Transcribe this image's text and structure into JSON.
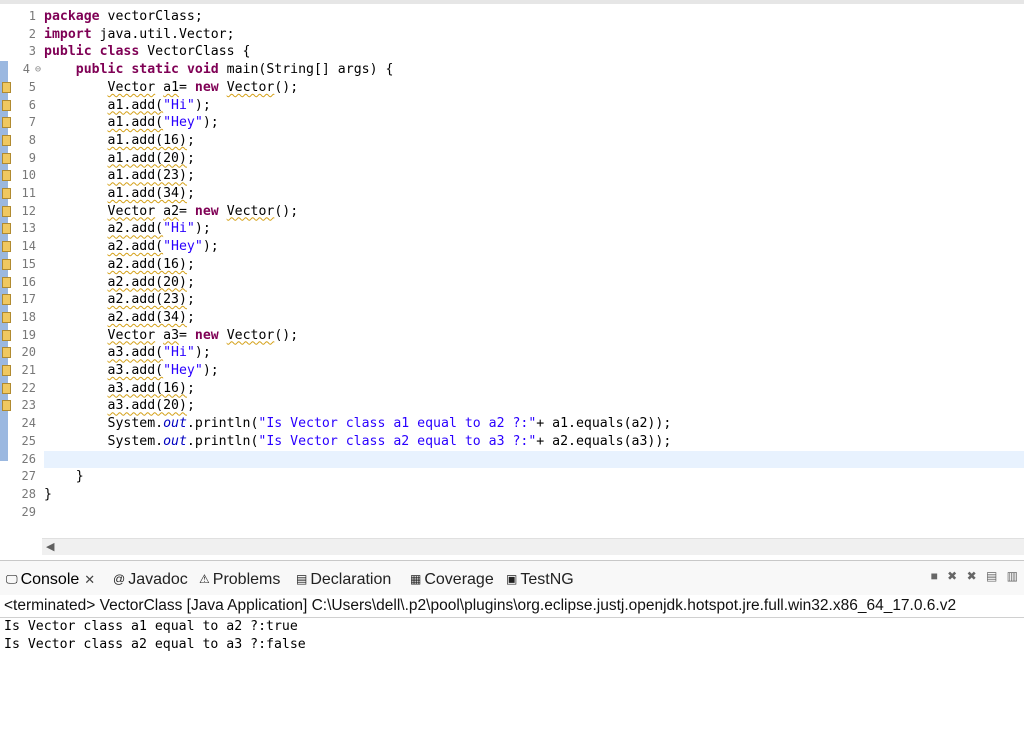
{
  "editor": {
    "lines": [
      {
        "n": "1",
        "parts": [
          [
            "kw",
            "package"
          ],
          [
            "t",
            " vectorClass;"
          ]
        ]
      },
      {
        "n": "2",
        "parts": [
          [
            "kw",
            "import"
          ],
          [
            "t",
            " java.util.Vector;"
          ]
        ]
      },
      {
        "n": "3",
        "parts": [
          [
            "kw",
            "public"
          ],
          [
            "t",
            " "
          ],
          [
            "kw",
            "class"
          ],
          [
            "t",
            " VectorClass {"
          ]
        ]
      },
      {
        "n": "4",
        "fold": "⊖",
        "parts": [
          [
            "t",
            "    "
          ],
          [
            "kw",
            "public"
          ],
          [
            "t",
            " "
          ],
          [
            "kw",
            "static"
          ],
          [
            "t",
            " "
          ],
          [
            "kw",
            "void"
          ],
          [
            "t",
            " main(String[] args) {"
          ]
        ]
      },
      {
        "n": "5",
        "marker": true,
        "parts": [
          [
            "t",
            "        "
          ],
          [
            "warn",
            "Vector"
          ],
          [
            "t",
            " "
          ],
          [
            "warn",
            "a1"
          ],
          [
            "t",
            "= "
          ],
          [
            "kw",
            "new"
          ],
          [
            "t",
            " "
          ],
          [
            "warn",
            "Vector"
          ],
          [
            "t",
            "();"
          ]
        ]
      },
      {
        "n": "6",
        "marker": true,
        "parts": [
          [
            "t",
            "        "
          ],
          [
            "warn",
            "a1.add("
          ],
          [
            "str",
            "\"Hi\""
          ],
          [
            "t",
            ");"
          ]
        ]
      },
      {
        "n": "7",
        "marker": true,
        "parts": [
          [
            "t",
            "        "
          ],
          [
            "warn",
            "a1.add("
          ],
          [
            "str",
            "\"Hey\""
          ],
          [
            "t",
            ");"
          ]
        ]
      },
      {
        "n": "8",
        "marker": true,
        "parts": [
          [
            "t",
            "        "
          ],
          [
            "warn",
            "a1.add(16)"
          ],
          [
            "t",
            ";"
          ]
        ]
      },
      {
        "n": "9",
        "marker": true,
        "parts": [
          [
            "t",
            "        "
          ],
          [
            "warn",
            "a1.add(20)"
          ],
          [
            "t",
            ";"
          ]
        ]
      },
      {
        "n": "10",
        "marker": true,
        "parts": [
          [
            "t",
            "        "
          ],
          [
            "warn",
            "a1.add(23)"
          ],
          [
            "t",
            ";"
          ]
        ]
      },
      {
        "n": "11",
        "marker": true,
        "parts": [
          [
            "t",
            "        "
          ],
          [
            "warn",
            "a1.add(34)"
          ],
          [
            "t",
            ";"
          ]
        ]
      },
      {
        "n": "12",
        "marker": true,
        "parts": [
          [
            "t",
            "        "
          ],
          [
            "warn",
            "Vector"
          ],
          [
            "t",
            " "
          ],
          [
            "warn",
            "a2"
          ],
          [
            "t",
            "= "
          ],
          [
            "kw",
            "new"
          ],
          [
            "t",
            " "
          ],
          [
            "warn",
            "Vector"
          ],
          [
            "t",
            "();"
          ]
        ]
      },
      {
        "n": "13",
        "marker": true,
        "parts": [
          [
            "t",
            "        "
          ],
          [
            "warn",
            "a2.add("
          ],
          [
            "str",
            "\"Hi\""
          ],
          [
            "t",
            ");"
          ]
        ]
      },
      {
        "n": "14",
        "marker": true,
        "parts": [
          [
            "t",
            "        "
          ],
          [
            "warn",
            "a2.add("
          ],
          [
            "str",
            "\"Hey\""
          ],
          [
            "t",
            ");"
          ]
        ]
      },
      {
        "n": "15",
        "marker": true,
        "parts": [
          [
            "t",
            "        "
          ],
          [
            "warn",
            "a2.add(16)"
          ],
          [
            "t",
            ";"
          ]
        ]
      },
      {
        "n": "16",
        "marker": true,
        "parts": [
          [
            "t",
            "        "
          ],
          [
            "warn",
            "a2.add(20)"
          ],
          [
            "t",
            ";"
          ]
        ]
      },
      {
        "n": "17",
        "marker": true,
        "parts": [
          [
            "t",
            "        "
          ],
          [
            "warn",
            "a2.add(23)"
          ],
          [
            "t",
            ";"
          ]
        ]
      },
      {
        "n": "18",
        "marker": true,
        "parts": [
          [
            "t",
            "        "
          ],
          [
            "warn",
            "a2.add(34)"
          ],
          [
            "t",
            ";"
          ]
        ]
      },
      {
        "n": "19",
        "marker": true,
        "parts": [
          [
            "t",
            "        "
          ],
          [
            "warn",
            "Vector"
          ],
          [
            "t",
            " "
          ],
          [
            "warn",
            "a3"
          ],
          [
            "t",
            "= "
          ],
          [
            "kw",
            "new"
          ],
          [
            "t",
            " "
          ],
          [
            "warn",
            "Vector"
          ],
          [
            "t",
            "();"
          ]
        ]
      },
      {
        "n": "20",
        "marker": true,
        "parts": [
          [
            "t",
            "        "
          ],
          [
            "warn",
            "a3.add("
          ],
          [
            "str",
            "\"Hi\""
          ],
          [
            "t",
            ");"
          ]
        ]
      },
      {
        "n": "21",
        "marker": true,
        "parts": [
          [
            "t",
            "        "
          ],
          [
            "warn",
            "a3.add("
          ],
          [
            "str",
            "\"Hey\""
          ],
          [
            "t",
            ");"
          ]
        ]
      },
      {
        "n": "22",
        "marker": true,
        "parts": [
          [
            "t",
            "        "
          ],
          [
            "warn",
            "a3.add(16)"
          ],
          [
            "t",
            ";"
          ]
        ]
      },
      {
        "n": "23",
        "marker": true,
        "parts": [
          [
            "t",
            "        "
          ],
          [
            "warn",
            "a3.add(20)"
          ],
          [
            "t",
            ";"
          ]
        ]
      },
      {
        "n": "24",
        "parts": [
          [
            "t",
            "        System."
          ],
          [
            "fld",
            "out"
          ],
          [
            "t",
            ".println("
          ],
          [
            "str",
            "\"Is Vector class a1 equal to a2 ?:\""
          ],
          [
            "t",
            "+ a1.equals(a2));"
          ]
        ]
      },
      {
        "n": "25",
        "parts": [
          [
            "t",
            "        System."
          ],
          [
            "fld",
            "out"
          ],
          [
            "t",
            ".println("
          ],
          [
            "str",
            "\"Is Vector class a2 equal to a3 ?:\""
          ],
          [
            "t",
            "+ a2.equals(a3));"
          ]
        ]
      },
      {
        "n": "26",
        "current": true,
        "parts": [
          [
            "t",
            ""
          ]
        ]
      },
      {
        "n": "27",
        "parts": [
          [
            "t",
            "    }"
          ]
        ]
      },
      {
        "n": "28",
        "parts": [
          [
            "t",
            "}"
          ]
        ]
      },
      {
        "n": "29",
        "parts": [
          [
            "t",
            ""
          ]
        ]
      }
    ]
  },
  "console": {
    "tabs": [
      {
        "id": "console",
        "icon": "console-icon",
        "glyph": "🖵",
        "label": "Console",
        "active": true,
        "closable": true
      },
      {
        "id": "javadoc",
        "icon": "at-icon",
        "glyph": "@",
        "label": "Javadoc"
      },
      {
        "id": "problems",
        "icon": "problems-icon",
        "glyph": "⚠",
        "label": "Problems"
      },
      {
        "id": "declaration",
        "icon": "declaration-icon",
        "glyph": "▤",
        "label": "Declaration"
      },
      {
        "id": "coverage",
        "icon": "coverage-icon",
        "glyph": "▦",
        "label": "Coverage"
      },
      {
        "id": "testng",
        "icon": "testng-icon",
        "glyph": "▣",
        "label": "TestNG"
      }
    ],
    "terminated_text": "<terminated> VectorClass [Java Application] C:\\Users\\dell\\.p2\\pool\\plugins\\org.eclipse.justj.openjdk.hotspot.jre.full.win32.x86_64_17.0.6.v2",
    "output": [
      "Is Vector class a1 equal to a2 ?:true",
      "Is Vector class a2 equal to a3 ?:false"
    ]
  }
}
